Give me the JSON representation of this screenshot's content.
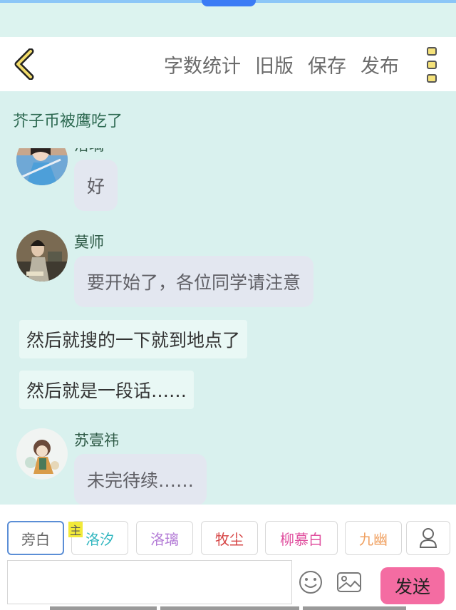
{
  "header": {
    "actions": [
      "字数统计",
      "旧版",
      "保存",
      "发布"
    ]
  },
  "chat": {
    "title": "芥子币被鹰吃了",
    "messages": [
      {
        "sender": "洛璃",
        "text": "好"
      },
      {
        "sender": "莫师",
        "text": "要开始了，各位同学请注意"
      },
      {
        "narration": "然后就搜的一下就到地点了"
      },
      {
        "narration": "然后就是一段话……"
      },
      {
        "sender": "苏壹祎",
        "text": "未完待续……"
      }
    ]
  },
  "roles": [
    {
      "label": "旁白",
      "color": "#666666"
    },
    {
      "label": "洛汐",
      "color": "#33b7c0"
    },
    {
      "label": "洛璃",
      "color": "#b37bd6"
    },
    {
      "label": "牧尘",
      "color": "#d64545"
    },
    {
      "label": "柳慕白",
      "color": "#e0509f"
    },
    {
      "label": "九幽",
      "color": "#f0a060"
    }
  ],
  "role_badge": "主",
  "input": {
    "placeholder": ""
  },
  "send_label": "发送"
}
